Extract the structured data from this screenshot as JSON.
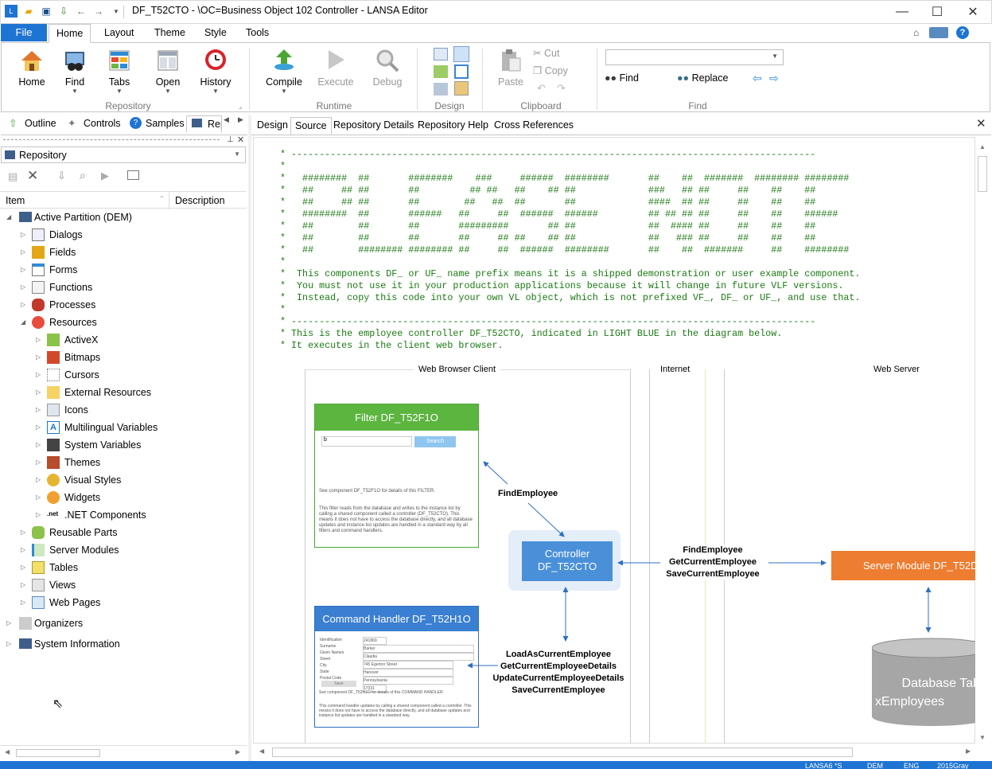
{
  "window": {
    "title": "DF_T52CTO - \\OC=Business Object 102 Controller - LANSA Editor",
    "minimize": "—",
    "maximize": "☐",
    "close": "✕"
  },
  "menu": {
    "file": "File",
    "tabs": [
      "Home",
      "Layout",
      "Theme",
      "Style",
      "Tools"
    ]
  },
  "ribbon": {
    "repository": {
      "buttons": [
        "Home",
        "Find",
        "Tabs",
        "Open",
        "History"
      ],
      "group": "Repository"
    },
    "runtime": {
      "buttons": [
        "Compile",
        "Execute",
        "Debug"
      ],
      "group": "Runtime"
    },
    "design": {
      "group": "Design"
    },
    "clipboard": {
      "paste": "Paste",
      "cut": "Cut",
      "copy": "Copy",
      "group": "Clipboard"
    },
    "find": {
      "find": "Find",
      "replace": "Replace",
      "group": "Find",
      "search_value": ""
    }
  },
  "left_tabs": [
    "Outline",
    "Controls",
    "Samples",
    "Rep"
  ],
  "repository_dropdown": "Repository",
  "columns": {
    "item": "Item",
    "description": "Description"
  },
  "tree": {
    "root": "Active Partition (DEM)",
    "items": [
      "Dialogs",
      "Fields",
      "Forms",
      "Functions",
      "Processes",
      "Resources"
    ],
    "resources": [
      "ActiveX",
      "Bitmaps",
      "Cursors",
      "External Resources",
      "Icons",
      "Multilingual Variables",
      "System Variables",
      "Themes",
      "Visual Styles",
      "Widgets",
      ".NET Components"
    ],
    "after": [
      "Reusable Parts",
      "Server Modules",
      "Tables",
      "Views",
      "Web Pages"
    ],
    "bottom": [
      "Organizers",
      "System Information"
    ]
  },
  "editor_tabs": [
    "Design",
    "Source",
    "Repository Details",
    "Repository Help",
    "Cross References"
  ],
  "code_lines": [
    "* ----------------------------------------------------------------------------------------------",
    "*",
    "*   ########  ##       ########    ###     ######  ########       ##    ##  #######  ######## ########",
    "*   ##     ## ##       ##         ## ##   ##    ## ##             ###   ## ##     ##    ##    ##",
    "*   ##     ## ##       ##        ##   ##  ##       ##             ####  ## ##     ##    ##    ##",
    "*   ########  ##       ######   ##     ##  ######  ######         ## ## ## ##     ##    ##    ######",
    "*   ##        ##       ##       #########       ## ##             ##  #### ##     ##    ##    ##",
    "*   ##        ##       ##       ##     ## ##    ## ##             ##   ### ##     ##    ##    ##",
    "*   ##        ######## ######## ##     ##  ######  ########       ##    ##  #######     ##    ########",
    "*",
    "*  This components DF_ or UF_ name prefix means it is a shipped demonstration or user example component.",
    "*  You must not use it in your production applications because it will change in future VLF versions.",
    "*  Instead, copy this code into your own VL object, which is not prefixed VF_, DF_ or UF_, and use that.",
    "*",
    "* ----------------------------------------------------------------------------------------------",
    "* This is the employee controller DF_T52CTO, indicated in LIGHT BLUE in the diagram below.",
    "* It executes in the client web browser."
  ],
  "diagram": {
    "zones": [
      "Web  Browser Client",
      "Internet",
      "Web Server"
    ],
    "filter": {
      "title": "Filter DF_T52F1O",
      "search": "Search",
      "input": "b",
      "note": "See component DF_T52F1O for details of this FILTER.",
      "desc": "This filter reads from the database and writes to the instance list by calling a shared component called a controller (DF_T52CTO). This means it does not have to access the database directly, and all database updates and instance list updates are handled in a standard way by all filters and command handlers."
    },
    "find_employee": "FindEmployee",
    "controller": [
      "Controller",
      "DF_T52CTO"
    ],
    "server_calls": [
      "FindEmployee",
      "GetCurrentEmployee",
      "SaveCurrentEmployee"
    ],
    "server_module": "Server Module DF_T52D",
    "command_handler": {
      "title": "Command Handler DF_T52H1O",
      "fields": [
        [
          "Identification",
          "Surname",
          "Given Names",
          "Street",
          "City",
          "State",
          "Postal Code"
        ],
        [
          "241869",
          "Barker",
          "Claudia",
          "745 Egerton Street",
          "Hanover",
          "Pennsylvania",
          "17331"
        ]
      ],
      "save": "Save",
      "note": "See component DF_T52H1O for details of this COMMAND HANDLER.",
      "desc": "This command handler updates by calling a shared component called a controller. This means it does not have to access the database directly, and all database updates and instance list updates are handled in a standard way."
    },
    "ch_calls": [
      "LoadAsCurrentEmployee",
      "GetCurrentEmployeeDetails",
      "UpdateCurrentEmployeeDetails",
      "SaveCurrentEmployee"
    ],
    "database": [
      "Database Table",
      "xEmployees"
    ]
  },
  "status": [
    "LANSA6 *S",
    "DEM",
    "ENG",
    "2015Gray"
  ]
}
